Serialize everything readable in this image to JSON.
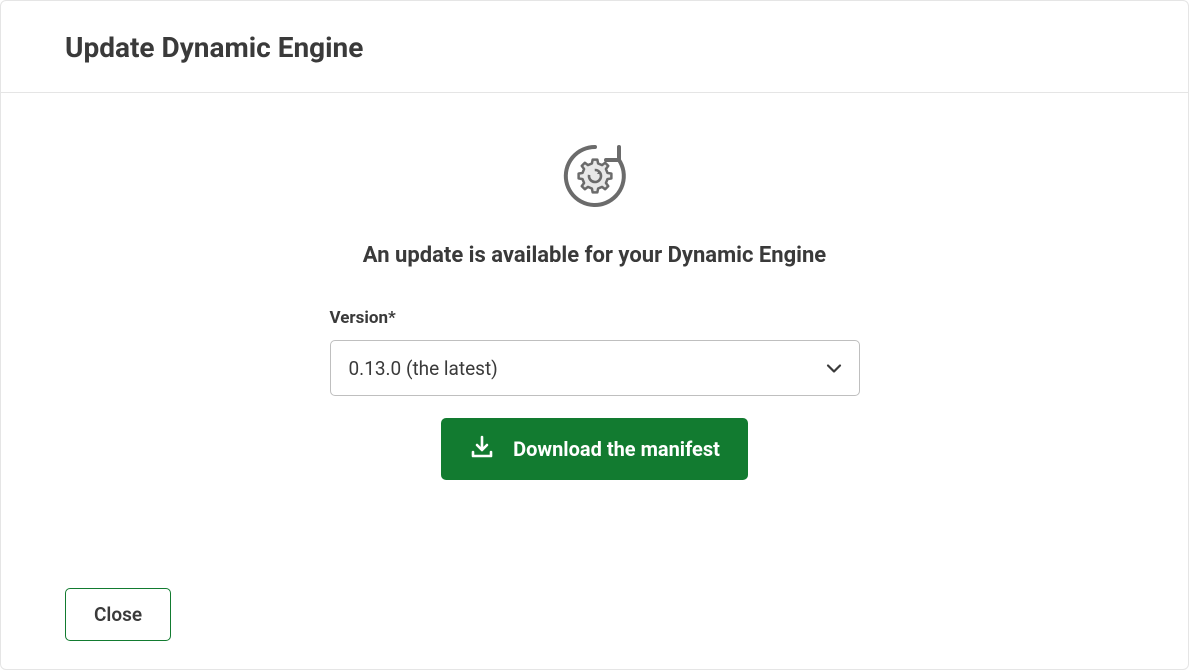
{
  "dialog": {
    "title": "Update Dynamic Engine"
  },
  "body": {
    "heading": "An update is available for your Dynamic Engine",
    "version_label": "Version*",
    "version_selected": "0.13.0 (the latest)",
    "download_label": "Download the manifest"
  },
  "footer": {
    "close_label": "Close"
  }
}
